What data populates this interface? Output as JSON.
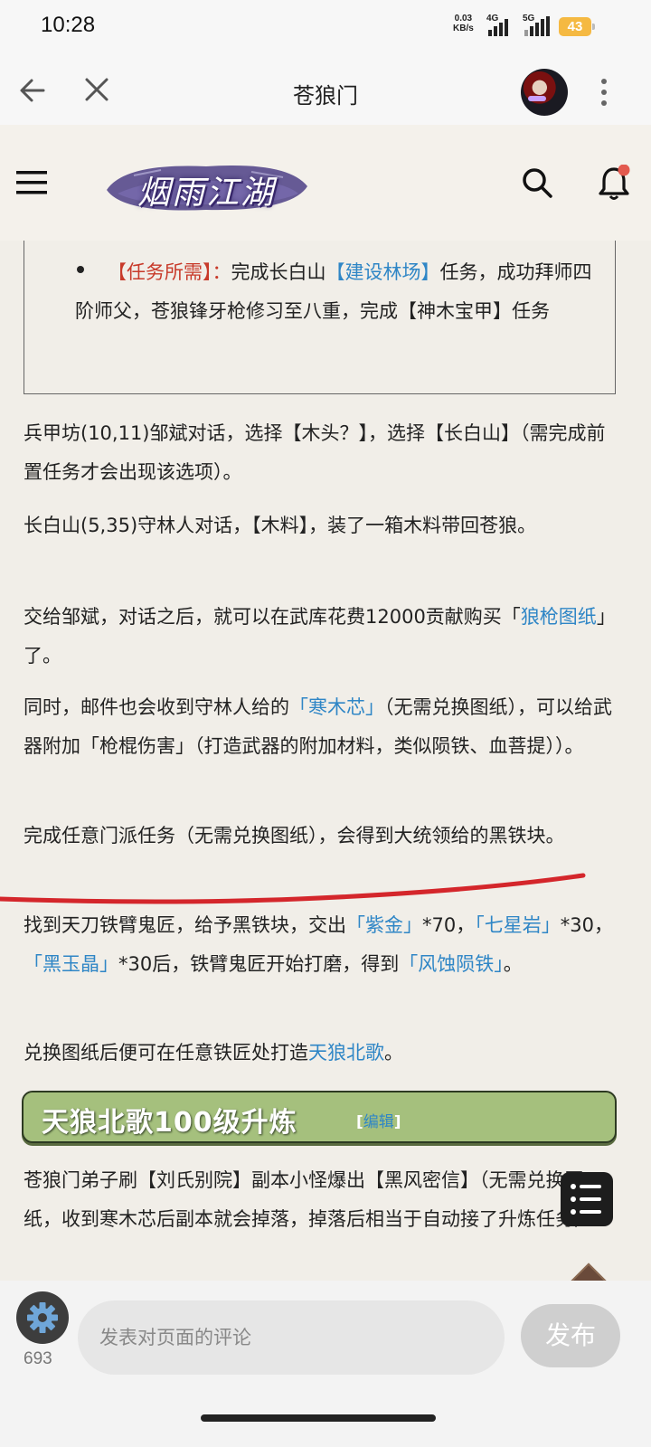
{
  "status_bar": {
    "time": "10:28",
    "net_speed": "0.03",
    "net_unit": "KB/s",
    "sim1": "4G",
    "sim2": "5G",
    "battery": "43"
  },
  "browser": {
    "title": "苍狼门"
  },
  "site": {
    "logo_text": "烟雨江湖",
    "accent_color": "#e35a4f"
  },
  "task_box": {
    "label": "【任务所需】：",
    "text1": "完成长白山",
    "link1": "【建设林场】",
    "text2": "任务，成功拜师四阶师父，苍狼锋牙枪修习至八重，完成【神木宝甲】任务"
  },
  "paragraphs": {
    "p1": "兵甲坊(10,11)邹斌对话，选择【木头？】，选择【长白山】（需完成前置任务才会出现该选项）。",
    "p2": "长白山(5,35)守林人对话，【木料】，装了一箱木料带回苍狼。",
    "p3_a": "交给邹斌，对话之后，就可以在武库花费12000贡献购买「",
    "p3_link": "狼枪图纸",
    "p3_b": "」了。",
    "p4_a": "同时，邮件也会收到守林人给的",
    "p4_link": "「寒木芯」",
    "p4_b": "（无需兑换图纸），可以给武器附加「枪棍伤害」（打造武器的附加材料，类似陨铁、血菩提））。",
    "p5": "完成任意门派任务（无需兑换图纸），会得到大统领给的黑铁块。",
    "p6_a": "找到天刀铁臂鬼匠，给予黑铁块，交出",
    "p6_link1": "「紫金」",
    "p6_b": "*70，",
    "p6_link2": "「七星岩」",
    "p6_c": "*30，",
    "p6_link3": "「黑玉晶」",
    "p6_d": "*30后，铁臂鬼匠开始打磨，得到",
    "p6_link4": "「风蚀陨铁」",
    "p6_e": "。",
    "p7_a": "兑换图纸后便可在任意铁匠处打造",
    "p7_link": "天狼北歌",
    "p7_b": "。",
    "p8": "苍狼门弟子刷【刘氏别院】副本小怪爆出【黑风密信】（无需兑换图纸，收到寒木芯后副本就会掉落，掉落后相当于自动接了升炼任务）"
  },
  "section": {
    "title": "天狼北歌100级升炼",
    "edit_open": "[",
    "edit_label": "编辑",
    "edit_close": "]"
  },
  "bottom_bar": {
    "comment_count": "693",
    "comment_placeholder": "发表对页面的评论",
    "publish_label": "发布"
  }
}
